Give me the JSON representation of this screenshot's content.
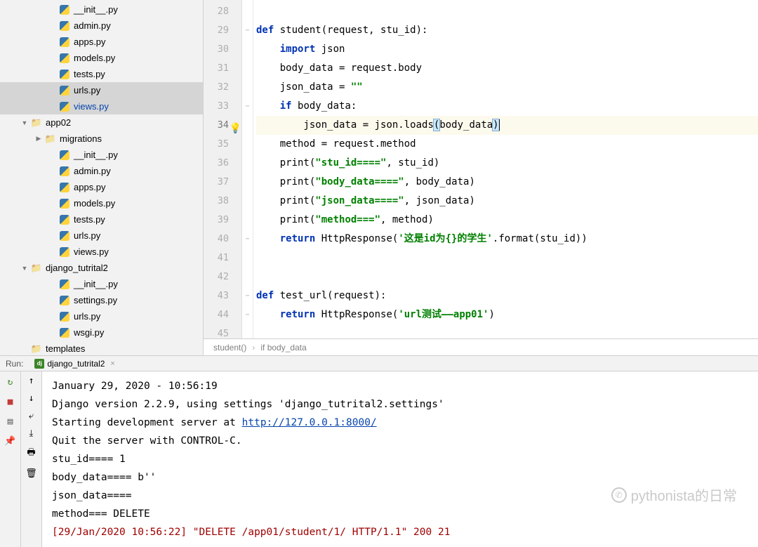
{
  "sidebar": {
    "items": [
      {
        "depth": 3,
        "name": "__init__.py",
        "icon": "py",
        "arrow": ""
      },
      {
        "depth": 3,
        "name": "admin.py",
        "icon": "py",
        "arrow": ""
      },
      {
        "depth": 3,
        "name": "apps.py",
        "icon": "py",
        "arrow": ""
      },
      {
        "depth": 3,
        "name": "models.py",
        "icon": "py",
        "arrow": ""
      },
      {
        "depth": 3,
        "name": "tests.py",
        "icon": "py",
        "arrow": ""
      },
      {
        "depth": 3,
        "name": "urls.py",
        "icon": "py",
        "arrow": "",
        "selected": true
      },
      {
        "depth": 3,
        "name": "views.py",
        "icon": "py",
        "arrow": "",
        "highlighted": true
      },
      {
        "depth": 1,
        "name": "app02",
        "icon": "pkg",
        "arrow": "▼"
      },
      {
        "depth": 2,
        "name": "migrations",
        "icon": "pkg",
        "arrow": "▶"
      },
      {
        "depth": 3,
        "name": "__init__.py",
        "icon": "py",
        "arrow": ""
      },
      {
        "depth": 3,
        "name": "admin.py",
        "icon": "py",
        "arrow": ""
      },
      {
        "depth": 3,
        "name": "apps.py",
        "icon": "py",
        "arrow": ""
      },
      {
        "depth": 3,
        "name": "models.py",
        "icon": "py",
        "arrow": ""
      },
      {
        "depth": 3,
        "name": "tests.py",
        "icon": "py",
        "arrow": ""
      },
      {
        "depth": 3,
        "name": "urls.py",
        "icon": "py",
        "arrow": ""
      },
      {
        "depth": 3,
        "name": "views.py",
        "icon": "py",
        "arrow": ""
      },
      {
        "depth": 1,
        "name": "django_tutrital2",
        "icon": "pkg",
        "arrow": "▼"
      },
      {
        "depth": 3,
        "name": "__init__.py",
        "icon": "py",
        "arrow": ""
      },
      {
        "depth": 3,
        "name": "settings.py",
        "icon": "py",
        "arrow": ""
      },
      {
        "depth": 3,
        "name": "urls.py",
        "icon": "py",
        "arrow": ""
      },
      {
        "depth": 3,
        "name": "wsgi.py",
        "icon": "py",
        "arrow": ""
      },
      {
        "depth": 1,
        "name": "templates",
        "icon": "folder",
        "arrow": ""
      }
    ]
  },
  "editor": {
    "line_start": 28,
    "lines": [
      {
        "n": 28,
        "fold": "",
        "tokens": []
      },
      {
        "n": 29,
        "fold": "⊖",
        "tokens": [
          {
            "t": "kw",
            "v": "def"
          },
          {
            "t": "sp",
            "v": " "
          },
          {
            "t": "id",
            "v": "student(request, stu_id):"
          }
        ]
      },
      {
        "n": 30,
        "fold": "",
        "indent": 1,
        "tokens": [
          {
            "t": "kw",
            "v": "import"
          },
          {
            "t": "sp",
            "v": " "
          },
          {
            "t": "id",
            "v": "json"
          }
        ]
      },
      {
        "n": 31,
        "fold": "",
        "indent": 1,
        "tokens": [
          {
            "t": "id",
            "v": "body_data = request.body"
          }
        ]
      },
      {
        "n": 32,
        "fold": "",
        "indent": 1,
        "tokens": [
          {
            "t": "id",
            "v": "json_data = "
          },
          {
            "t": "str",
            "v": "\"\""
          }
        ]
      },
      {
        "n": 33,
        "fold": "⊖",
        "indent": 1,
        "tokens": [
          {
            "t": "kw",
            "v": "if"
          },
          {
            "t": "sp",
            "v": " "
          },
          {
            "t": "id",
            "v": "body_data:"
          }
        ]
      },
      {
        "n": 34,
        "fold": "",
        "hl": true,
        "bulb": true,
        "indent": 2,
        "tokens": [
          {
            "t": "id",
            "v": "json_data = json.loads"
          },
          {
            "t": "pm",
            "v": "("
          },
          {
            "t": "id",
            "v": "body_data"
          },
          {
            "t": "pm",
            "v": ")"
          },
          {
            "t": "caret",
            "v": ""
          }
        ]
      },
      {
        "n": 35,
        "fold": "",
        "indent": 1,
        "tokens": [
          {
            "t": "id",
            "v": "method = request.method"
          }
        ]
      },
      {
        "n": 36,
        "fold": "",
        "indent": 1,
        "tokens": [
          {
            "t": "id",
            "v": "print("
          },
          {
            "t": "str",
            "v": "\"stu_id====\""
          },
          {
            "t": "id",
            "v": ", stu_id)"
          }
        ]
      },
      {
        "n": 37,
        "fold": "",
        "indent": 1,
        "tokens": [
          {
            "t": "id",
            "v": "print("
          },
          {
            "t": "str",
            "v": "\"body_data====\""
          },
          {
            "t": "id",
            "v": ", body_data)"
          }
        ]
      },
      {
        "n": 38,
        "fold": "",
        "indent": 1,
        "tokens": [
          {
            "t": "id",
            "v": "print("
          },
          {
            "t": "str",
            "v": "\"json_data====\""
          },
          {
            "t": "id",
            "v": ", json_data)"
          }
        ]
      },
      {
        "n": 39,
        "fold": "",
        "indent": 1,
        "tokens": [
          {
            "t": "id",
            "v": "print("
          },
          {
            "t": "str",
            "v": "\"method===\""
          },
          {
            "t": "id",
            "v": ", method)"
          }
        ]
      },
      {
        "n": 40,
        "fold": "⊖",
        "indent": 1,
        "tokens": [
          {
            "t": "kw",
            "v": "return"
          },
          {
            "t": "sp",
            "v": " "
          },
          {
            "t": "id",
            "v": "HttpResponse("
          },
          {
            "t": "str",
            "v": "'这是id为{}的学生'"
          },
          {
            "t": "id",
            "v": ".format(stu_id))"
          }
        ]
      },
      {
        "n": 41,
        "fold": "",
        "tokens": []
      },
      {
        "n": 42,
        "fold": "",
        "tokens": []
      },
      {
        "n": 43,
        "fold": "⊖",
        "tokens": [
          {
            "t": "kw",
            "v": "def"
          },
          {
            "t": "sp",
            "v": " "
          },
          {
            "t": "id",
            "v": "test_url(request):"
          }
        ]
      },
      {
        "n": 44,
        "fold": "⊖",
        "indent": 1,
        "tokens": [
          {
            "t": "kw",
            "v": "return"
          },
          {
            "t": "sp",
            "v": " "
          },
          {
            "t": "id",
            "v": "HttpResponse("
          },
          {
            "t": "str",
            "v": "'url测试——app01'"
          },
          {
            "t": "id",
            "v": ")"
          }
        ]
      },
      {
        "n": 45,
        "fold": "",
        "tokens": []
      }
    ],
    "breadcrumb": [
      "student()",
      "if body_data"
    ]
  },
  "run": {
    "label": "Run:",
    "tab_name": "django_tutrital2",
    "console_lines": [
      {
        "segs": [
          {
            "t": "plain",
            "v": "January 29, 2020 - 10:56:19"
          }
        ]
      },
      {
        "segs": [
          {
            "t": "plain",
            "v": "Django version 2.2.9, using settings 'django_tutrital2.settings'"
          }
        ]
      },
      {
        "segs": [
          {
            "t": "plain",
            "v": "Starting development server at "
          },
          {
            "t": "link",
            "v": "http://127.0.0.1:8000/"
          }
        ]
      },
      {
        "segs": [
          {
            "t": "plain",
            "v": "Quit the server with CONTROL-C."
          }
        ]
      },
      {
        "segs": [
          {
            "t": "plain",
            "v": "stu_id==== 1"
          }
        ]
      },
      {
        "segs": [
          {
            "t": "plain",
            "v": "body_data==== b''"
          }
        ]
      },
      {
        "segs": [
          {
            "t": "plain",
            "v": "json_data===="
          }
        ]
      },
      {
        "segs": [
          {
            "t": "plain",
            "v": "method=== DELETE"
          }
        ]
      },
      {
        "segs": [
          {
            "t": "req",
            "v": "[29/Jan/2020 10:56:22] \"DELETE /app01/student/1/ HTTP/1.1\" 200 21"
          }
        ]
      }
    ]
  },
  "watermark": "pythonista的日常"
}
